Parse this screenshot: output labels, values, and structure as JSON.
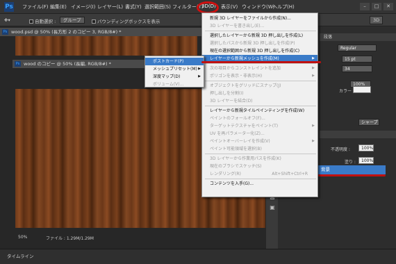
{
  "app": {
    "logo": "Ps"
  },
  "menubar": {
    "items": [
      "ファイル(F)",
      "編集(E)",
      "イメージ(I)",
      "レイヤー(L)",
      "書式(Y)",
      "選択範囲(S)",
      "フィルター(T)",
      "3D(D)",
      "表示(V)",
      "ウィンドウ(W)",
      "ヘルプ(H)"
    ],
    "window_controls": [
      "–",
      "□",
      "✕"
    ]
  },
  "options": {
    "auto_select": "自動選択 :",
    "group": "グループ",
    "transform": "バウンディングボックスを表示",
    "workspace": "3D"
  },
  "documents": {
    "tab1": "wood.psd @ 50% (長方形 2 のコピー 3, RGB/8#) *",
    "tab2": "wood のコピー @ 50% (長編, RGB/8#) *"
  },
  "status": {
    "zoom": "50%",
    "file": "ファイル : 1.29M/1.29M"
  },
  "timeline": "タイムライン",
  "menu3d": {
    "items": [
      {
        "label": "新規 3D レイヤーをファイルから作成(N)...",
        "enabled": true
      },
      {
        "label": "3D レイヤーを書き出し(E)...",
        "enabled": false
      },
      {
        "label": "選択したレイヤーから新規 3D 押し出しを作成(L)",
        "enabled": true
      },
      {
        "label": "選択したパスから新規 3D 押し出しを作成(P)",
        "enabled": false
      },
      {
        "label": "現在の選択範囲から新規 3D 押し出しを作成(C)",
        "enabled": true
      },
      {
        "label": "レイヤーから新規メッシュを作成(M)",
        "enabled": true,
        "highlighted": true,
        "submenu": true
      },
      {
        "label": "次の項目からコンストレイントを追加",
        "enabled": false,
        "submenu": true
      },
      {
        "label": "ポリゴンを表示・非表示(H)",
        "enabled": false,
        "submenu": true
      },
      {
        "label": "オブジェクトをグリッドにスナップ(J)",
        "enabled": false
      },
      {
        "label": "押し出しを分割(I)",
        "enabled": false
      },
      {
        "label": "3D レイヤーを結合(D)",
        "enabled": false
      },
      {
        "label": "レイヤーから新規タイルペインティングを作成(W)",
        "enabled": true
      },
      {
        "label": "ペイントのフォールオフ(F)...",
        "enabled": false
      },
      {
        "label": "ターゲットテクスチャをペイント(T)",
        "enabled": false,
        "submenu": true
      },
      {
        "label": "UV を再パラメーター化(Z)...",
        "enabled": false
      },
      {
        "label": "ペイントオーバーレイを作成(V)",
        "enabled": false,
        "submenu": true
      },
      {
        "label": "ペイント可能領域を選択(B)",
        "enabled": false
      },
      {
        "label": "3D レイヤーから作業用パスを作成(K)",
        "enabled": false
      },
      {
        "label": "現在のブラシでスケッチ(S)",
        "enabled": false
      },
      {
        "label": "レンダリング(R)",
        "enabled": false,
        "shortcut": "Alt+Shift+Ctrl+R"
      },
      {
        "label": "コンテンツを入手(G)...",
        "enabled": true
      }
    ]
  },
  "submenu": {
    "items": [
      {
        "label": "ポストカード(P)",
        "highlighted": true
      },
      {
        "label": "メッシュプリセット(M)",
        "submenu": true
      },
      {
        "label": "深度マップ(D)",
        "submenu": true
      },
      {
        "label": "ボリューム(V)...",
        "enabled": false
      }
    ]
  },
  "rpanel": {
    "tab": "段落",
    "font_style": "Regular",
    "font_size": "15 pt",
    "leading": "34",
    "scale": "100%",
    "color_label": "カラー :",
    "sharp": "シャープ",
    "opacity_label": "不透明度 :",
    "opacity": "100%",
    "fill_label": "塗り :",
    "fill": "100%",
    "layer_name": "背景"
  },
  "colors": {
    "highlight": "#3a7bc8",
    "annotation": "#c01010"
  }
}
